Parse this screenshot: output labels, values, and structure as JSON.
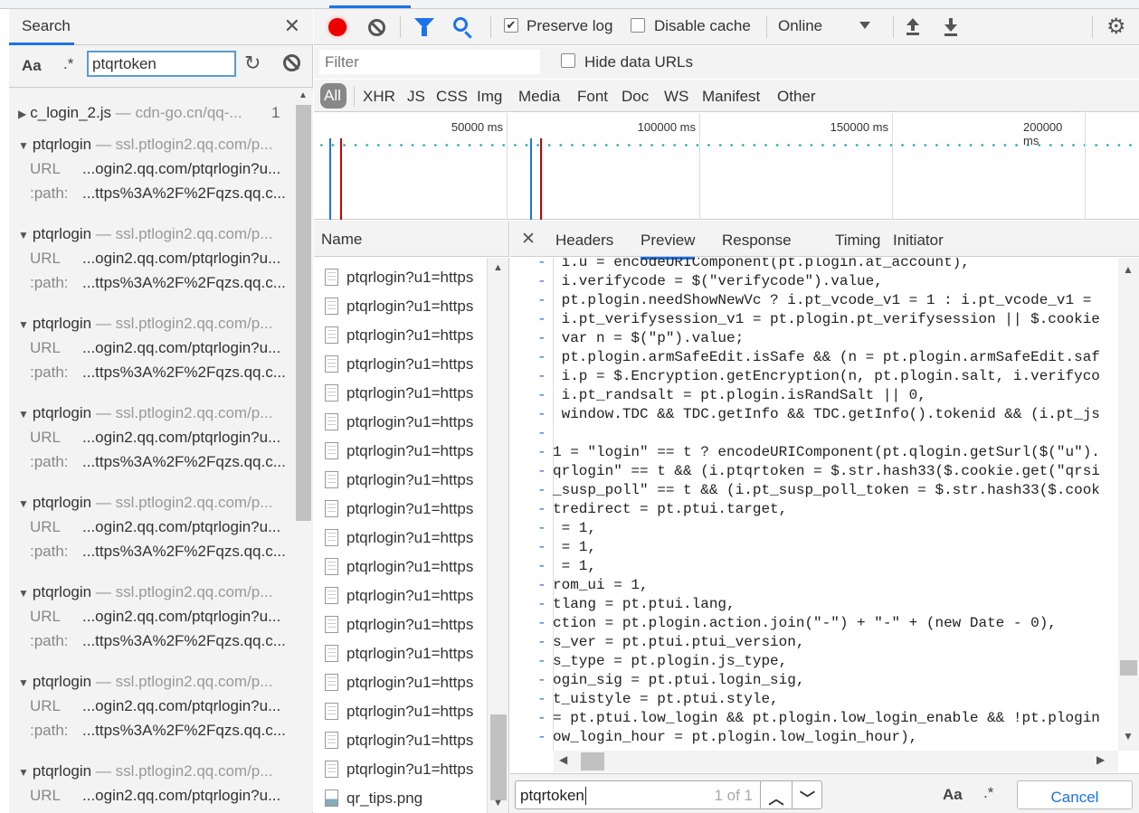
{
  "search_panel": {
    "tab_label": "Search",
    "case_toggle": "Aa",
    "regex_toggle": ".*",
    "query": "ptqrtoken",
    "results": [
      {
        "name": "c_login_2.js",
        "domain": "cdn-go.cn/qq-...",
        "count": "1",
        "expanded": false
      },
      {
        "name": "ptqrlogin",
        "domain": "ssl.ptlogin2.qq.com/p...",
        "expanded": true,
        "url_key": "URL",
        "url": "...ogin2.qq.com/ptqrlogin?u...",
        "path_key": ":path:",
        "path": "...ttps%3A%2F%2Fqzs.qq.c..."
      },
      {
        "name": "ptqrlogin",
        "domain": "ssl.ptlogin2.qq.com/p...",
        "expanded": true,
        "url_key": "URL",
        "url": "...ogin2.qq.com/ptqrlogin?u...",
        "path_key": ":path:",
        "path": "...ttps%3A%2F%2Fqzs.qq.c..."
      },
      {
        "name": "ptqrlogin",
        "domain": "ssl.ptlogin2.qq.com/p...",
        "expanded": true,
        "url_key": "URL",
        "url": "...ogin2.qq.com/ptqrlogin?u...",
        "path_key": ":path:",
        "path": "...ttps%3A%2F%2Fqzs.qq.c..."
      },
      {
        "name": "ptqrlogin",
        "domain": "ssl.ptlogin2.qq.com/p...",
        "expanded": true,
        "url_key": "URL",
        "url": "...ogin2.qq.com/ptqrlogin?u...",
        "path_key": ":path:",
        "path": "...ttps%3A%2F%2Fqzs.qq.c..."
      },
      {
        "name": "ptqrlogin",
        "domain": "ssl.ptlogin2.qq.com/p...",
        "expanded": true,
        "url_key": "URL",
        "url": "...ogin2.qq.com/ptqrlogin?u...",
        "path_key": ":path:",
        "path": "...ttps%3A%2F%2Fqzs.qq.c..."
      },
      {
        "name": "ptqrlogin",
        "domain": "ssl.ptlogin2.qq.com/p...",
        "expanded": true,
        "url_key": "URL",
        "url": "...ogin2.qq.com/ptqrlogin?u...",
        "path_key": ":path:",
        "path": "...ttps%3A%2F%2Fqzs.qq.c..."
      },
      {
        "name": "ptqrlogin",
        "domain": "ssl.ptlogin2.qq.com/p...",
        "expanded": true,
        "url_key": "URL",
        "url": "...ogin2.qq.com/ptqrlogin?u...",
        "path_key": ":path:",
        "path": "...ttps%3A%2F%2Fqzs.qq.c..."
      },
      {
        "name": "ptqrlogin",
        "domain": "ssl.ptlogin2.qq.com/p...",
        "expanded": true,
        "url_key": "URL",
        "url": "...ogin2.qq.com/ptqrlogin?u...",
        "path_key": ":path:",
        "path": "...ttps%3A%2F%2Fqzs.qq.c..."
      }
    ]
  },
  "toolbar": {
    "preserve_log": {
      "label": "Preserve log",
      "checked": true
    },
    "disable_cache": {
      "label": "Disable cache",
      "checked": false
    },
    "throttling": "Online"
  },
  "filter": {
    "placeholder": "Filter",
    "hide_data_urls": {
      "label": "Hide data URLs",
      "checked": false
    },
    "types": [
      "All",
      "XHR",
      "JS",
      "CSS",
      "Img",
      "Media",
      "Font",
      "Doc",
      "WS",
      "Manifest",
      "Other"
    ],
    "active_type": "All"
  },
  "timeline": {
    "ticks": [
      "50000 ms",
      "100000 ms",
      "150000 ms",
      "200000 ms"
    ]
  },
  "requests": {
    "header": "Name",
    "items": [
      "ptqrlogin?u1=https",
      "ptqrlogin?u1=https",
      "ptqrlogin?u1=https",
      "ptqrlogin?u1=https",
      "ptqrlogin?u1=https",
      "ptqrlogin?u1=https",
      "ptqrlogin?u1=https",
      "ptqrlogin?u1=https",
      "ptqrlogin?u1=https",
      "ptqrlogin?u1=https",
      "ptqrlogin?u1=https",
      "ptqrlogin?u1=https",
      "ptqrlogin?u1=https",
      "ptqrlogin?u1=https",
      "ptqrlogin?u1=https",
      "ptqrlogin?u1=https",
      "ptqrlogin?u1=https",
      "ptqrlogin?u1=https",
      "qr_tips.png"
    ]
  },
  "detail": {
    "tabs": [
      "Headers",
      "Preview",
      "Response",
      "Timing",
      "Initiator"
    ],
    "active_tab": "Preview",
    "code_lines": [
      " i.u = encodeURIComponent(pt.plogin.at_account),",
      " i.verifycode = $(\"verifycode\").value,",
      " pt.plogin.needShowNewVc ? i.pt_vcode_v1 = 1 : i.pt_vcode_v1 =",
      " i.pt_verifysession_v1 = pt.plogin.pt_verifysession || $.cookie",
      " var n = $(\"p\").value;",
      " pt.plogin.armSafeEdit.isSafe && (n = pt.plogin.armSafeEdit.saf",
      " i.p = $.Encryption.getEncryption(n, pt.plogin.salt, i.verifyco",
      " i.pt_randsalt = pt.plogin.isRandSalt || 0,",
      " window.TDC && TDC.getInfo && TDC.getInfo().tokenid && (i.pt_js",
      "",
      "1 = \"login\" == t ? encodeURIComponent(pt.qlogin.getSurl($(\"u\").",
      "qrlogin\" == t && (i.ptqrtoken = $.str.hash33($.cookie.get(\"qrsi",
      "_susp_poll\" == t && (i.pt_susp_poll_token = $.str.hash33($.cook",
      "tredirect = pt.ptui.target,",
      " = 1,",
      " = 1,",
      " = 1,",
      "rom_ui = 1,",
      "tlang = pt.ptui.lang,",
      "ction = pt.plogin.action.join(\"-\") + \"-\" + (new Date - 0),",
      "s_ver = pt.ptui.ptui_version,",
      "s_type = pt.plogin.js_type,",
      "ogin_sig = pt.ptui.login_sig,",
      "t_uistyle = pt.ptui.style,",
      "= pt.ptui.low_login && pt.plogin.low_login_enable && !pt.plogin",
      "ow_login_hour = pt.plogin.low_login_hour),",
      ""
    ],
    "boxed_match": "(i.ptqrtoken = $.str.hash33"
  },
  "find": {
    "query": "ptqrtoken",
    "match_count": "1 of 1",
    "case_toggle": "Aa",
    "regex_toggle": ".*",
    "cancel_label": "Cancel"
  },
  "colors": {
    "accent": "#1a73e8",
    "record": "#ee0000",
    "match_highlight": "#ffea00",
    "match_box": "#e0282c"
  }
}
